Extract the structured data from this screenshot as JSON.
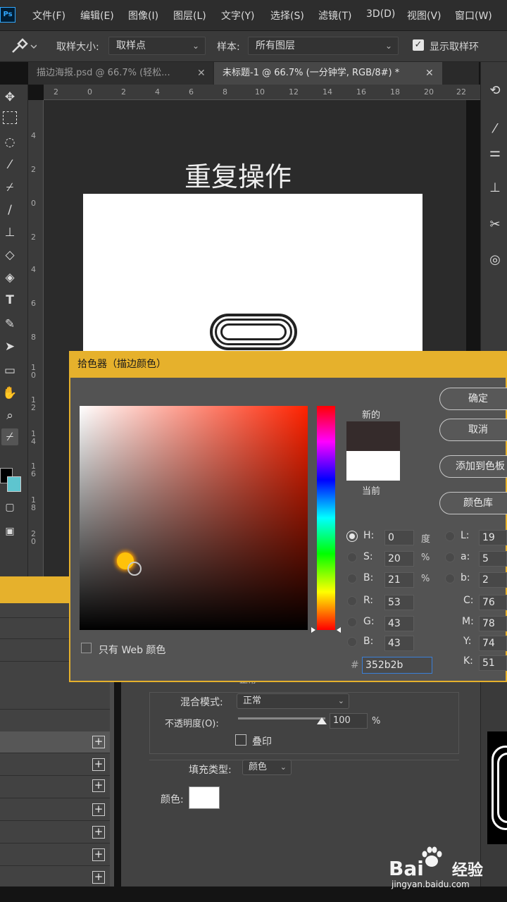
{
  "app": {
    "logo": "Ps"
  },
  "menu": [
    "文件(F)",
    "编辑(E)",
    "图像(I)",
    "图层(L)",
    "文字(Y)",
    "选择(S)",
    "滤镜(T)",
    "3D(D)",
    "视图(V)",
    "窗口(W)"
  ],
  "options_bar": {
    "tool_icon": "eyedropper-icon",
    "sample_size_label": "取样大小:",
    "sample_size_value": "取样点",
    "sample_label": "样本:",
    "sample_value": "所有图层",
    "show_ring_label": "显示取样环",
    "show_ring_checked": true
  },
  "tabs": [
    {
      "label": "描边海报.psd @ 66.7% (轻松...",
      "active": false
    },
    {
      "label": "未标题-1 @ 66.7% (一分钟学, RGB/8#) *",
      "active": true
    }
  ],
  "ruler_top": [
    "2",
    "0",
    "2",
    "4",
    "6",
    "8",
    "10",
    "12",
    "14",
    "16",
    "18",
    "20",
    "22"
  ],
  "ruler_left": [
    "4",
    "2",
    "0",
    "2",
    "4",
    "6",
    "8",
    "1 0",
    "1 2",
    "1 4",
    "1 6",
    "1 8",
    "2 0"
  ],
  "canvas": {
    "title": "重复操作"
  },
  "picker": {
    "title": "拾色器（描边颜色）",
    "new_label": "新的",
    "current_label": "当前",
    "new_color": "#352b2b",
    "current_color": "#ffffff",
    "buttons": {
      "ok": "确定",
      "cancel": "取消",
      "add_swatch": "添加到色板",
      "libraries": "颜色库"
    },
    "web_only_label": "只有 Web 颜色",
    "hsb": {
      "H": "0",
      "S": "20",
      "B": "21",
      "h_unit": "度",
      "pct": "%"
    },
    "rgb": {
      "R": "53",
      "G": "43",
      "B": "43"
    },
    "lab": {
      "L": "19",
      "a": "5",
      "b": "2"
    },
    "cmyk": {
      "C": "76",
      "M": "78",
      "Y": "74",
      "K": "51"
    },
    "hex_symbol": "#",
    "hex": "352b2b",
    "selected_mode": "H"
  },
  "stroke_panel": {
    "blend_mode_label": "混合模式:",
    "blend_mode_value": "正常",
    "opacity_label": "不透明度(O):",
    "opacity_value": "100",
    "opacity_unit": "%",
    "opacity_fraction": 1.0,
    "knockout_label": "叠印",
    "fill_type_label": "填充类型:",
    "fill_type_value": "颜色",
    "color_label": "颜色:",
    "fill_color": "#ffffff",
    "partial_value": "正常"
  },
  "watermark": {
    "brand": "Bai",
    "brand_cn": "经验",
    "url": "jingyan.baidu.com"
  }
}
